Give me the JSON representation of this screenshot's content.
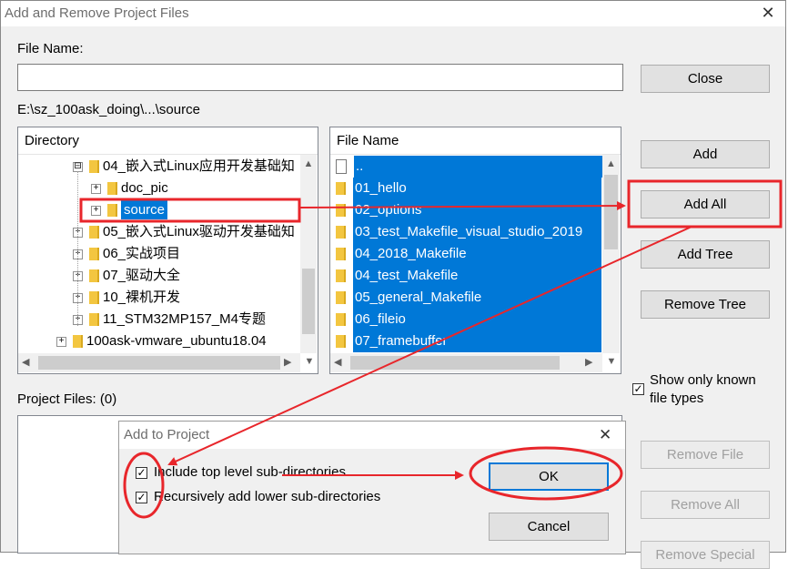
{
  "dialog": {
    "title": "Add and Remove Project Files",
    "close_x": "✕",
    "file_name_label": "File Name:",
    "file_name_value": "",
    "path": "E:\\sz_100ask_doing\\...\\source",
    "directory_header": "Directory",
    "file_name_header": "File Name",
    "project_files_label": "Project Files: (0)",
    "show_known_label_line1": "Show only known",
    "show_known_label_line2": "file types",
    "show_known_checked": "✓"
  },
  "buttons": {
    "close": "Close",
    "add": "Add",
    "add_all": "Add All",
    "add_tree": "Add Tree",
    "remove_tree": "Remove Tree",
    "remove_file": "Remove File",
    "remove_all": "Remove All",
    "remove_special": "Remove Special"
  },
  "directory_tree": [
    {
      "label": "04_嵌入式Linux应用开发基础知",
      "expander": "⊟"
    },
    {
      "label": "doc_pic",
      "expander": "+"
    },
    {
      "label": "source",
      "expander": "+",
      "selected": true
    },
    {
      "label": "05_嵌入式Linux驱动开发基础知",
      "expander": "+"
    },
    {
      "label": "06_实战项目",
      "expander": "+"
    },
    {
      "label": "07_驱动大全",
      "expander": "+"
    },
    {
      "label": "10_裸机开发",
      "expander": "+"
    },
    {
      "label": "11_STM32MP157_M4专题",
      "expander": "+"
    },
    {
      "label": "100ask-vmware_ubuntu18.04",
      "expander": "+"
    }
  ],
  "file_list": [
    "..",
    "01_hello",
    "02_options",
    "03_test_Makefile_visual_studio_2019",
    "04_2018_Makefile",
    "04_test_Makefile",
    "05_general_Makefile",
    "06_fileio",
    "07_framebuffer"
  ],
  "sub_dialog": {
    "title": "Add to Project",
    "close_x": "✕",
    "include_top_label": "Include top level sub-directories",
    "recursive_label": "Recursively add lower sub-directories",
    "check_mark": "✓",
    "ok": "OK",
    "cancel": "Cancel"
  },
  "annotation_color": "#e8262b"
}
